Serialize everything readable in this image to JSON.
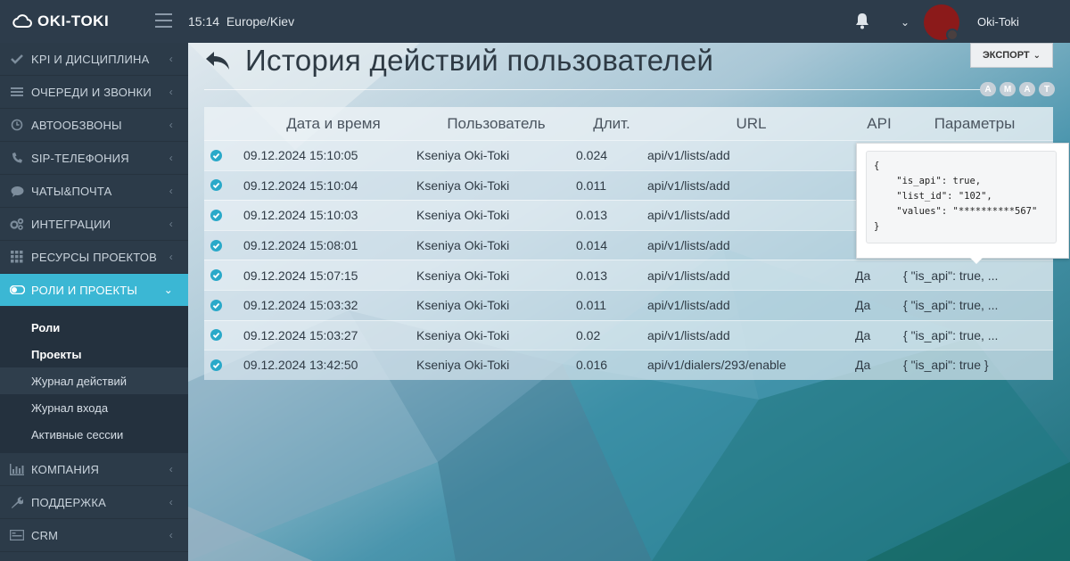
{
  "app": {
    "logo_text": "OKI-TOKI",
    "time": "15:14",
    "timezone": "Europe/Kiev",
    "username": "Oki-Toki"
  },
  "sidebar": {
    "items": [
      {
        "label": "KPI И ДИСЦИПЛИНА",
        "icon": "check-icon"
      },
      {
        "label": "ОЧЕРЕДИ И ЗВОНКИ",
        "icon": "list-icon"
      },
      {
        "label": "АВТООБЗВОНЫ",
        "icon": "clock-icon"
      },
      {
        "label": "SIP-ТЕЛЕФОНИЯ",
        "icon": "phone-icon"
      },
      {
        "label": "ЧАТЫ&ПОЧТА",
        "icon": "chat-icon"
      },
      {
        "label": "ИНТЕГРАЦИИ",
        "icon": "cogs-icon"
      },
      {
        "label": "РЕСУРСЫ ПРОЕКТОВ",
        "icon": "grid-icon"
      },
      {
        "label": "РОЛИ И ПРОЕКТЫ",
        "icon": "toggle-icon"
      }
    ],
    "subitems": [
      {
        "label": "Роли"
      },
      {
        "label": "Проекты"
      },
      {
        "label": "Журнал действий"
      },
      {
        "label": "Журнал входа"
      },
      {
        "label": "Активные сессии"
      }
    ],
    "bottom_items": [
      {
        "label": "КОМПАНИЯ",
        "icon": "bar-chart-icon"
      },
      {
        "label": "ПОДДЕРЖКА",
        "icon": "wrench-icon"
      },
      {
        "label": "CRM",
        "icon": "card-icon"
      }
    ]
  },
  "page": {
    "title": "История действий пользователей",
    "export_label": "ЭКСПОРТ",
    "letters": [
      "A",
      "M",
      "A",
      "T"
    ]
  },
  "table": {
    "headers": {
      "datetime": "Дата и время",
      "user": "Пользователь",
      "duration": "Длит.",
      "url": "URL",
      "api": "API",
      "params": "Параметры"
    },
    "rows": [
      {
        "datetime": "09.12.2024 15:10:05",
        "user": "Kseniya Oki-Toki",
        "duration": "0.024",
        "url": "api/v1/lists/add",
        "api": "",
        "params": ""
      },
      {
        "datetime": "09.12.2024 15:10:04",
        "user": "Kseniya Oki-Toki",
        "duration": "0.011",
        "url": "api/v1/lists/add",
        "api": "",
        "params": ""
      },
      {
        "datetime": "09.12.2024 15:10:03",
        "user": "Kseniya Oki-Toki",
        "duration": "0.013",
        "url": "api/v1/lists/add",
        "api": "",
        "params": ""
      },
      {
        "datetime": "09.12.2024 15:08:01",
        "user": "Kseniya Oki-Toki",
        "duration": "0.014",
        "url": "api/v1/lists/add",
        "api": "",
        "params": ""
      },
      {
        "datetime": "09.12.2024 15:07:15",
        "user": "Kseniya Oki-Toki",
        "duration": "0.013",
        "url": "api/v1/lists/add",
        "api": "Да",
        "params": "{ \"is_api\": true, ..."
      },
      {
        "datetime": "09.12.2024 15:03:32",
        "user": "Kseniya Oki-Toki",
        "duration": "0.011",
        "url": "api/v1/lists/add",
        "api": "Да",
        "params": "{ \"is_api\": true, ..."
      },
      {
        "datetime": "09.12.2024 15:03:27",
        "user": "Kseniya Oki-Toki",
        "duration": "0.02",
        "url": "api/v1/lists/add",
        "api": "Да",
        "params": "{ \"is_api\": true, ..."
      },
      {
        "datetime": "09.12.2024 13:42:50",
        "user": "Kseniya Oki-Toki",
        "duration": "0.016",
        "url": "api/v1/dialers/293/enable",
        "api": "Да",
        "params": "{ \"is_api\": true }"
      }
    ]
  },
  "tooltip": {
    "text": "{\n    \"is_api\": true,\n    \"list_id\": \"102\",\n    \"values\": \"**********567\"\n}"
  },
  "colors": {
    "topbar": "#2d3c4b",
    "sidebar": "#2c3b49",
    "accent": "#3bb7d4",
    "check": "#2aa9c9"
  }
}
